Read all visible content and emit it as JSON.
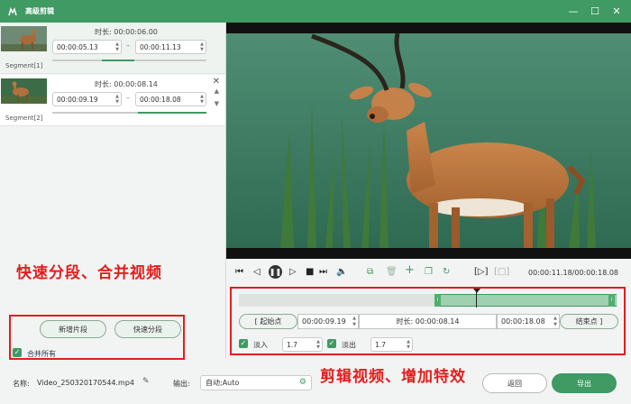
{
  "window": {
    "title": "高级剪辑",
    "minimize": "—",
    "maximize": "☐",
    "close": "✕"
  },
  "segments": [
    {
      "label": "Segment[1]",
      "duration": "时长: 00:00:06.00",
      "start": "00:00:05.13",
      "end": "00:00:11.13"
    },
    {
      "label": "Segment[2]",
      "duration": "时长: 00:00:08.14",
      "start": "00:00:09.19",
      "end": "00:00:18.08"
    }
  ],
  "left_panel": {
    "annotation": "快速分段、合并视频",
    "add_segment": "新增片段",
    "quick_split": "快速分段",
    "merge_all": "合并所有"
  },
  "player": {
    "time": "00:00:11.18/00:00:18.08"
  },
  "editor": {
    "start_btn": "[ 起始点",
    "start_time": "00:00:09.19",
    "duration": "时长: 00:00:08.14",
    "end_time": "00:00:18.08",
    "end_btn": "结束点 ]",
    "fade_in_label": "淡入",
    "fade_in_value": "1.7",
    "fade_out_label": "淡出",
    "fade_out_value": "1.7",
    "annotation": "剪辑视频、增加特效"
  },
  "bottom": {
    "name_label": "名称:",
    "name_value": "Video_250320170544.mp4",
    "output_label": "输出:",
    "output_value": "自动;Auto",
    "back": "返回",
    "export": "导出"
  },
  "colors": {
    "accent": "#3f9a63",
    "annotation": "#e31d1d"
  }
}
